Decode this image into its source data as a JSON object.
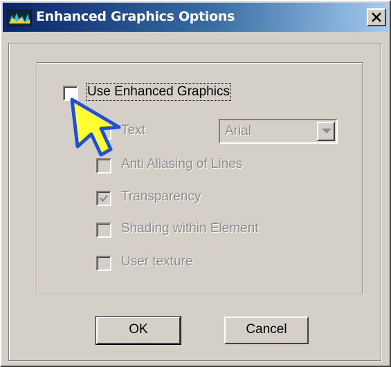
{
  "window": {
    "title": "Enhanced Graphics Options"
  },
  "main": {
    "use_enhanced": {
      "label": "Use Enhanced Graphics",
      "checked": false
    },
    "options": [
      {
        "label": "Text",
        "checked": false,
        "enabled": false
      },
      {
        "label": "Anti Aliasing of Lines",
        "checked": false,
        "enabled": false
      },
      {
        "label": "Transparency",
        "checked": true,
        "enabled": false
      },
      {
        "label": "Shading within Element",
        "checked": false,
        "enabled": false
      },
      {
        "label": "User texture",
        "checked": false,
        "enabled": false
      }
    ],
    "font_select": {
      "value": "Arial",
      "enabled": false
    }
  },
  "buttons": {
    "ok": "OK",
    "cancel": "Cancel"
  },
  "colors": {
    "dialog_bg": "#d4d0c8",
    "title_gradient_start": "#0a246a",
    "title_gradient_end": "#a6caf0",
    "pointer_fill": "#ffff33",
    "pointer_outline": "#1f4fd8"
  },
  "icons": {
    "app": "app-icon",
    "close": "close-icon",
    "pointer": "pointer-arrow-icon",
    "dropdown": "chevron-down-icon"
  }
}
